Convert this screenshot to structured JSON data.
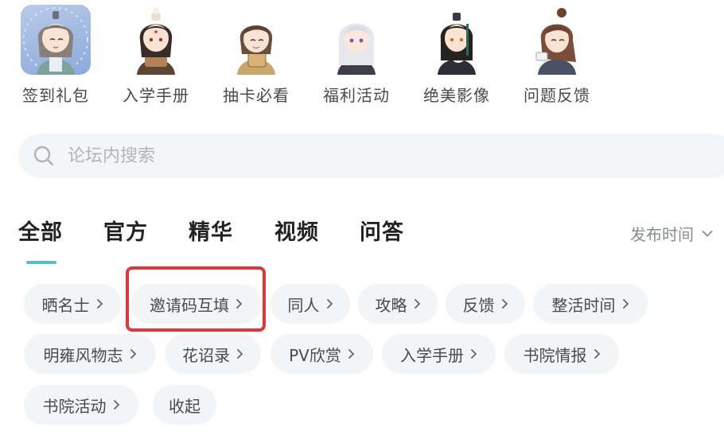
{
  "shortcuts": [
    {
      "label": "签到礼包",
      "icon": "check-in-gift-avatar"
    },
    {
      "label": "入学手册",
      "icon": "admission-handbook-avatar"
    },
    {
      "label": "抽卡必看",
      "icon": "gacha-guide-avatar"
    },
    {
      "label": "福利活动",
      "icon": "welfare-event-avatar"
    },
    {
      "label": "绝美影像",
      "icon": "gallery-avatar"
    },
    {
      "label": "问题反馈",
      "icon": "feedback-avatar"
    }
  ],
  "search": {
    "placeholder": "论坛内搜索"
  },
  "tabs": [
    {
      "label": "全部",
      "active": true
    },
    {
      "label": "官方"
    },
    {
      "label": "精华"
    },
    {
      "label": "视频"
    },
    {
      "label": "问答"
    }
  ],
  "sort": {
    "label": "发布时间"
  },
  "chips": [
    {
      "label": "晒名士"
    },
    {
      "label": "邀请码互填"
    },
    {
      "label": "同人"
    },
    {
      "label": "攻略"
    },
    {
      "label": "反馈"
    },
    {
      "label": "整活时间"
    },
    {
      "label": "明雍风物志"
    },
    {
      "label": "花诏录"
    },
    {
      "label": "PV欣赏"
    },
    {
      "label": "入学手册"
    },
    {
      "label": "书院情报"
    },
    {
      "label": "书院活动"
    },
    {
      "label": "收起"
    }
  ],
  "colors": {
    "accent": "#53c0c9",
    "highlight_border": "#e0363b",
    "chip_bg": "#f3f4f6",
    "search_bg": "#f4f5f7"
  }
}
